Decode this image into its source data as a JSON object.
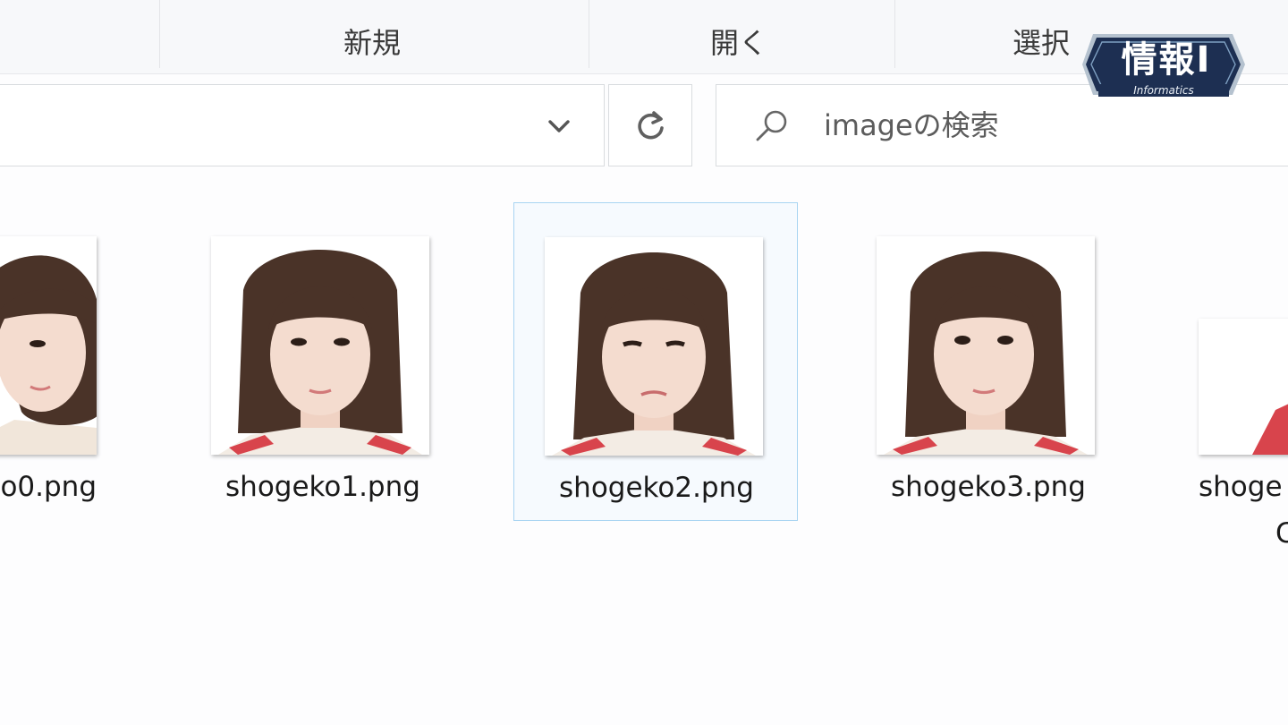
{
  "ribbon": {
    "new_label": "新規",
    "open_label": "開く",
    "select_label": "選択"
  },
  "logo": {
    "title": "情報Ⅰ",
    "subtitle": "Informatics"
  },
  "address": {
    "dropdown_icon": "chevron-down-icon",
    "refresh_icon": "refresh-icon"
  },
  "search": {
    "placeholder": "imageの検索",
    "icon": "search-icon"
  },
  "files": [
    {
      "name": "o0.png",
      "thumbnail": "portrait-photo"
    },
    {
      "name": "shogeko1.png",
      "thumbnail": "portrait-photo"
    },
    {
      "name": "shogeko2.png",
      "thumbnail": "portrait-photo",
      "selected": true
    },
    {
      "name": "shogeko3.png",
      "thumbnail": "portrait-photo"
    },
    {
      "name": "shoge",
      "name_line2": "C",
      "thumbnail": "portrait-photo"
    }
  ],
  "colors": {
    "selection_border": "#a8d4f2",
    "logo_navy": "#1d2f52",
    "hair": "#4a3328",
    "skin": "#f4dccf",
    "uniform_red": "#d8444c"
  }
}
